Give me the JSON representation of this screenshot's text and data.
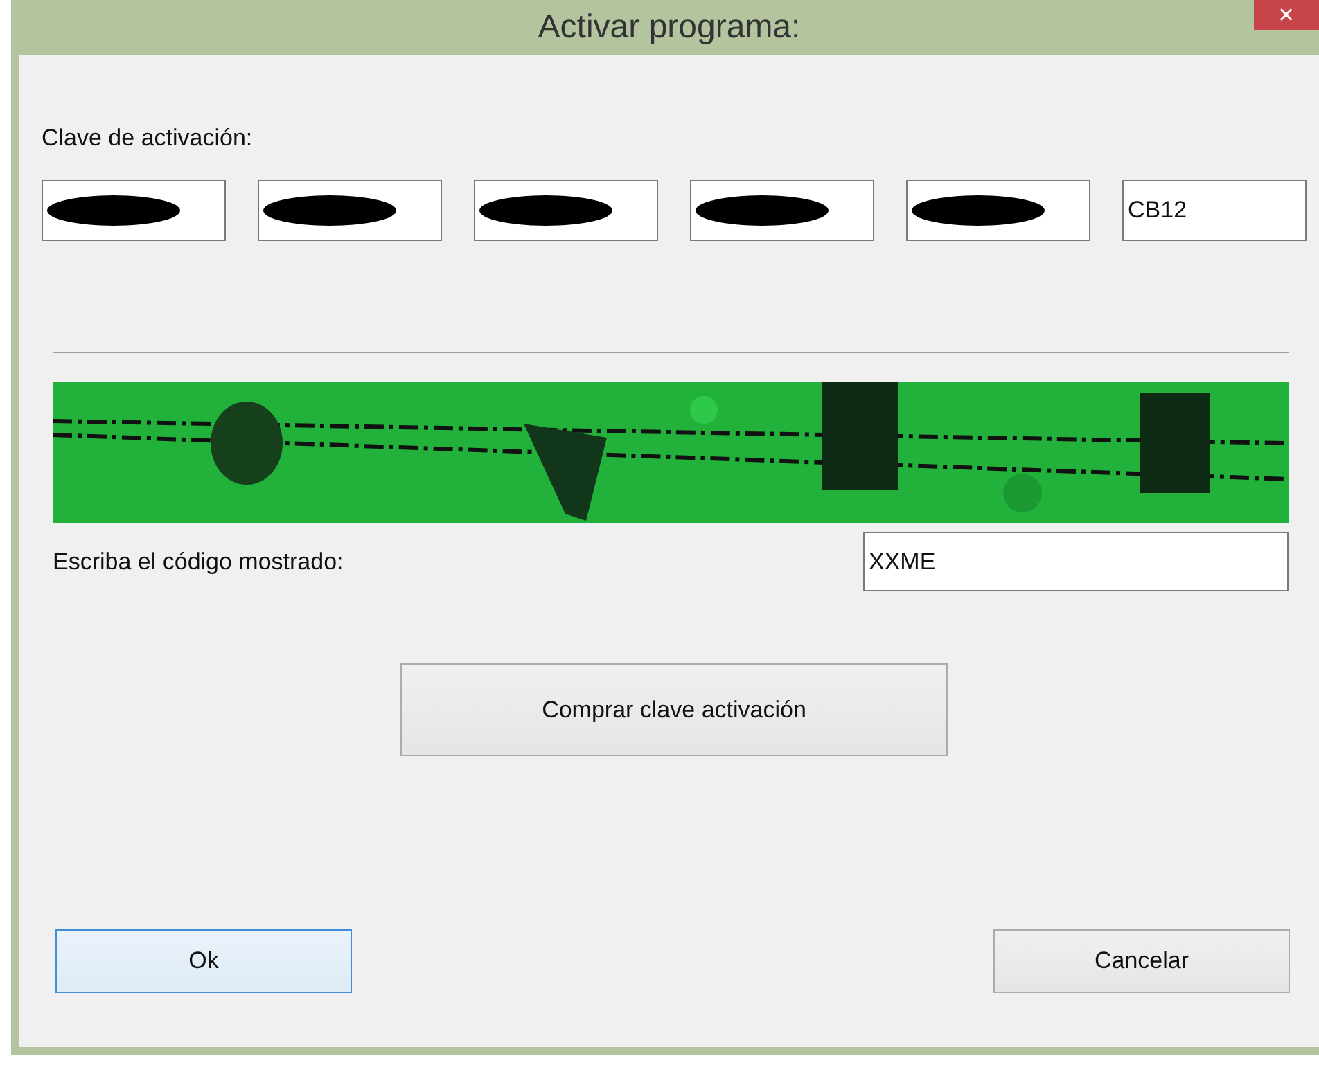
{
  "window": {
    "title": "Activar programa:",
    "close_glyph": "✕"
  },
  "activation_key": {
    "label": "Clave de activación:",
    "fields": [
      {
        "redacted": true
      },
      {
        "redacted": true
      },
      {
        "redacted": true
      },
      {
        "redacted": true
      },
      {
        "redacted": true
      },
      {
        "redacted": false,
        "value": "CB12"
      }
    ]
  },
  "captcha": {
    "label": "Escriba el código mostrado:",
    "value": "XXME"
  },
  "buy_button": "Comprar clave activación",
  "buttons": [
    {
      "label": "Ok",
      "default": true
    },
    {
      "label": "Cancelar",
      "default": false
    }
  ]
}
